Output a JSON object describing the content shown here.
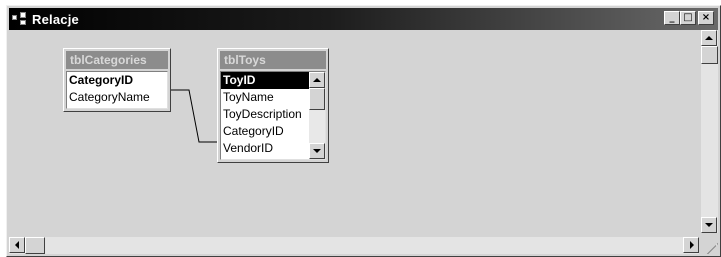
{
  "window": {
    "title": "Relacje",
    "minimize_label": "_",
    "maximize_label": "□",
    "close_label": "×"
  },
  "tables": [
    {
      "name": "tblCategories",
      "fields": [
        "CategoryID",
        "CategoryName"
      ]
    },
    {
      "name": "tblToys",
      "fields": [
        "ToyID",
        "ToyName",
        "ToyDescription",
        "CategoryID",
        "VendorID"
      ]
    }
  ],
  "relationship": {
    "from": "tblCategories.CategoryID",
    "to": "tblToys.CategoryID"
  }
}
